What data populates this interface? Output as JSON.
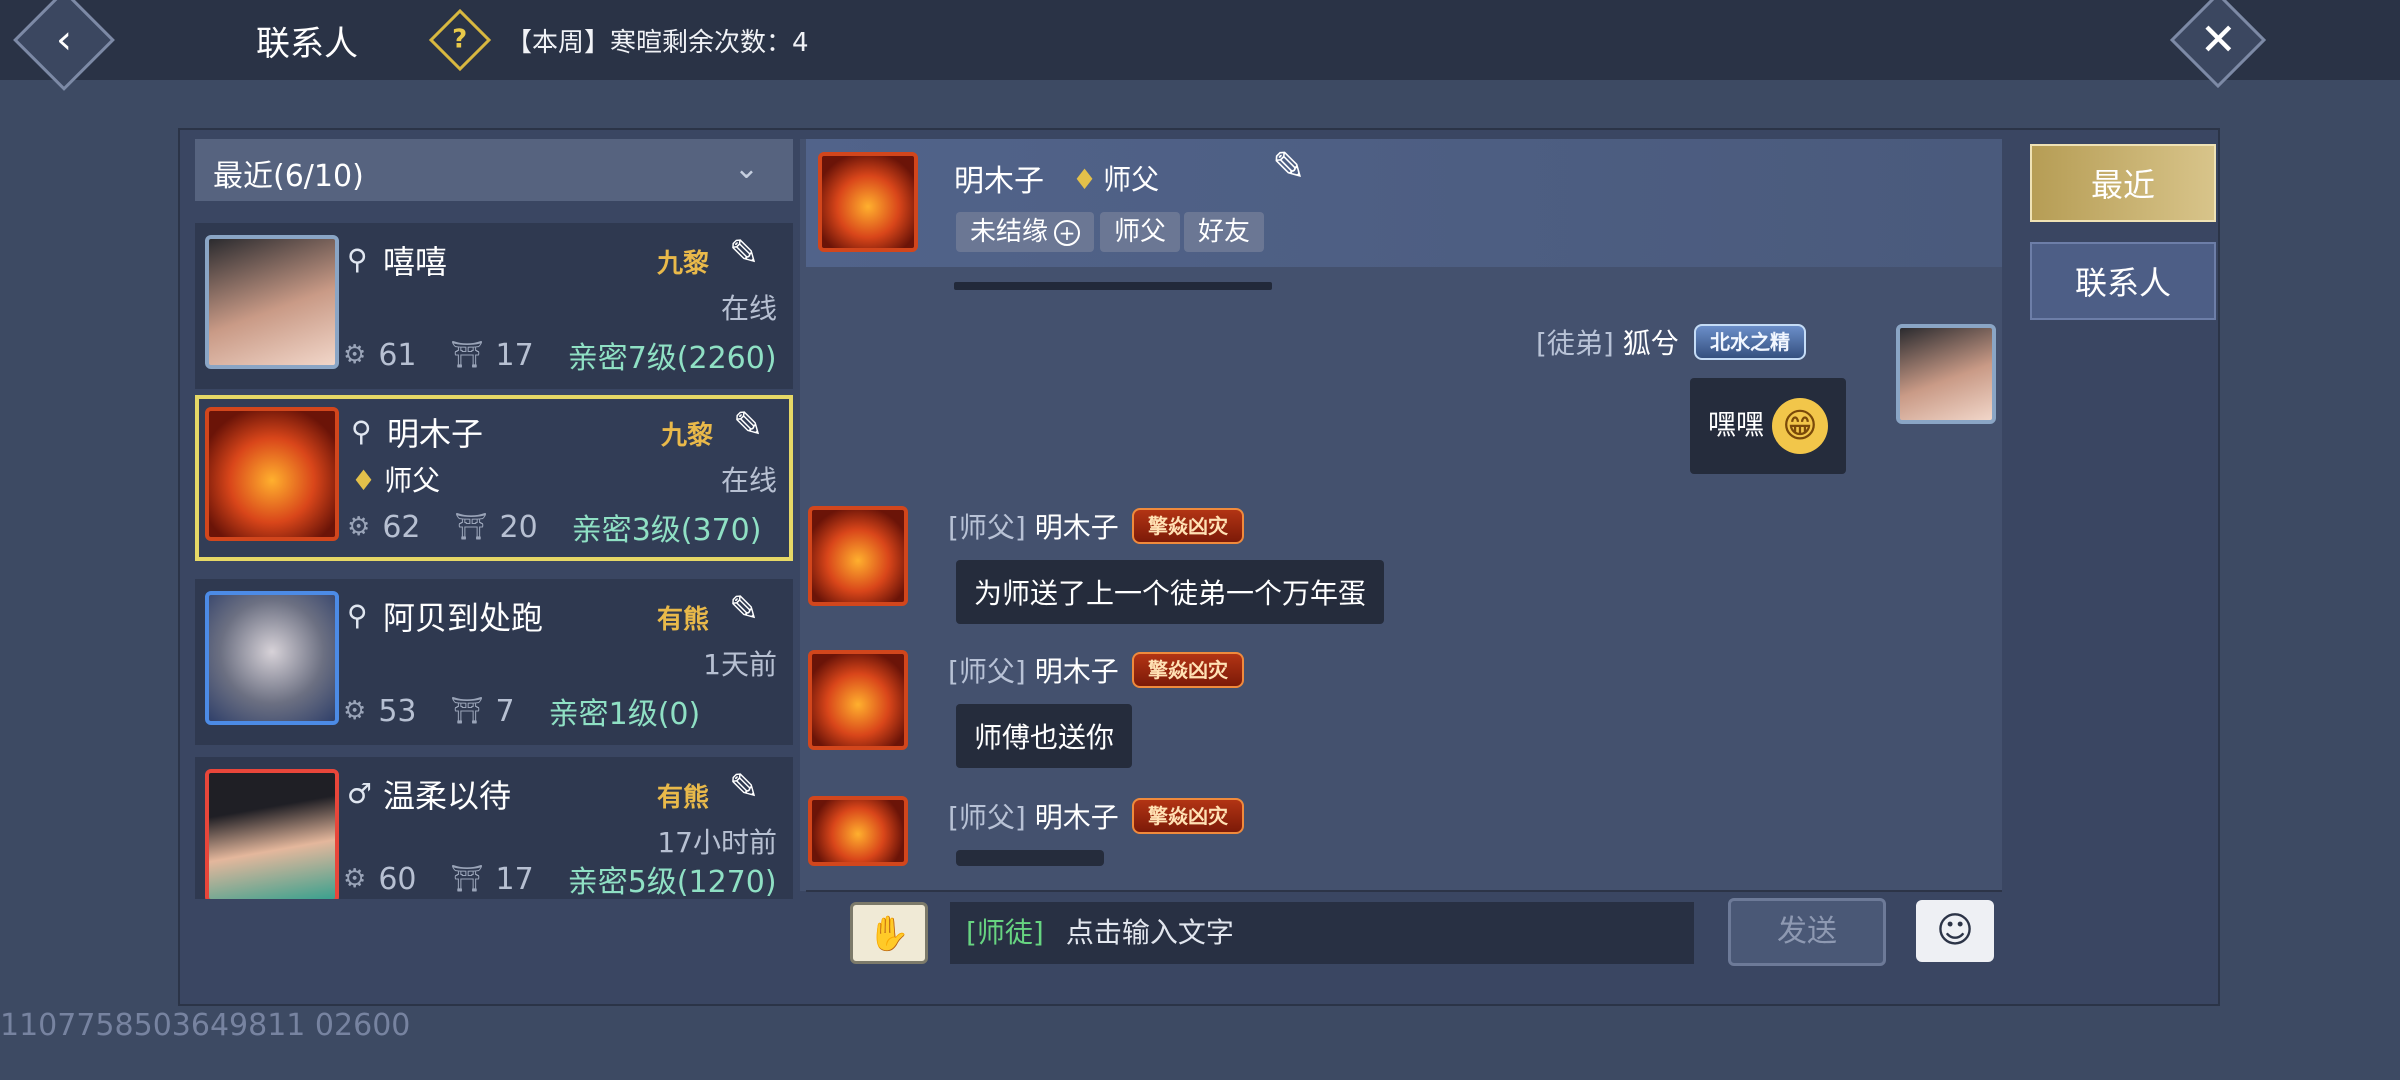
{
  "topbar": {
    "back_icon": "‹",
    "title": "联系人",
    "help_icon": "?",
    "weekly_text": "【本周】寒暄剩余次数：4",
    "close_icon": "✕"
  },
  "filter": {
    "label": "最近(6/10)",
    "chevron": "⌄"
  },
  "contacts": [
    {
      "gender_icon": "⚲",
      "name": "嘻嘻",
      "server": "九黎",
      "status": "在线",
      "title": "",
      "stat1": "61",
      "stat2": "17",
      "intimacy": "亲密7级(2260)"
    },
    {
      "gender_icon": "⚲",
      "name": "明木子",
      "server": "九黎",
      "status": "在线",
      "title": "师父",
      "stat1": "62",
      "stat2": "20",
      "intimacy": "亲密3级(370)"
    },
    {
      "gender_icon": "⚲",
      "name": "阿贝到处跑",
      "server": "有熊",
      "status": "1天前",
      "title": "",
      "stat1": "53",
      "stat2": "7",
      "intimacy": "亲密1级(0)"
    },
    {
      "gender_icon": "♂",
      "name": "温柔以待",
      "server": "有熊",
      "status": "17小时前",
      "title": "",
      "stat1": "60",
      "stat2": "17",
      "intimacy": "亲密5级(1270)"
    }
  ],
  "chat_header": {
    "name": "明木子",
    "title": "师父",
    "tags": [
      "未结缘",
      "师父",
      "好友"
    ]
  },
  "messages": [
    {
      "role": "[徒弟]",
      "name": "狐兮",
      "badge": "北水之精",
      "text": "嘿嘿",
      "emoji": "😁"
    },
    {
      "role": "[师父]",
      "name": "明木子",
      "badge": "擎焱凶灾",
      "text": "为师送了上一个徒弟一个万年蛋"
    },
    {
      "role": "[师父]",
      "name": "明木子",
      "badge": "擎焱凶灾",
      "text": "师傅也送你"
    },
    {
      "role": "[师父]",
      "name": "明木子",
      "badge": "擎焱凶灾",
      "text": ""
    }
  ],
  "input": {
    "channel": "[师徒]",
    "placeholder": "点击输入文字",
    "send_label": "发送",
    "voice_icon": "✋",
    "emote_icon": "☺"
  },
  "tabs": {
    "recent": "最近",
    "contacts": "联系人"
  },
  "icons": {
    "chat": "✎",
    "stat1": "⚙",
    "stat2": "⛩",
    "title_mark": "♦"
  },
  "watermark": "1107758503649811 02600"
}
